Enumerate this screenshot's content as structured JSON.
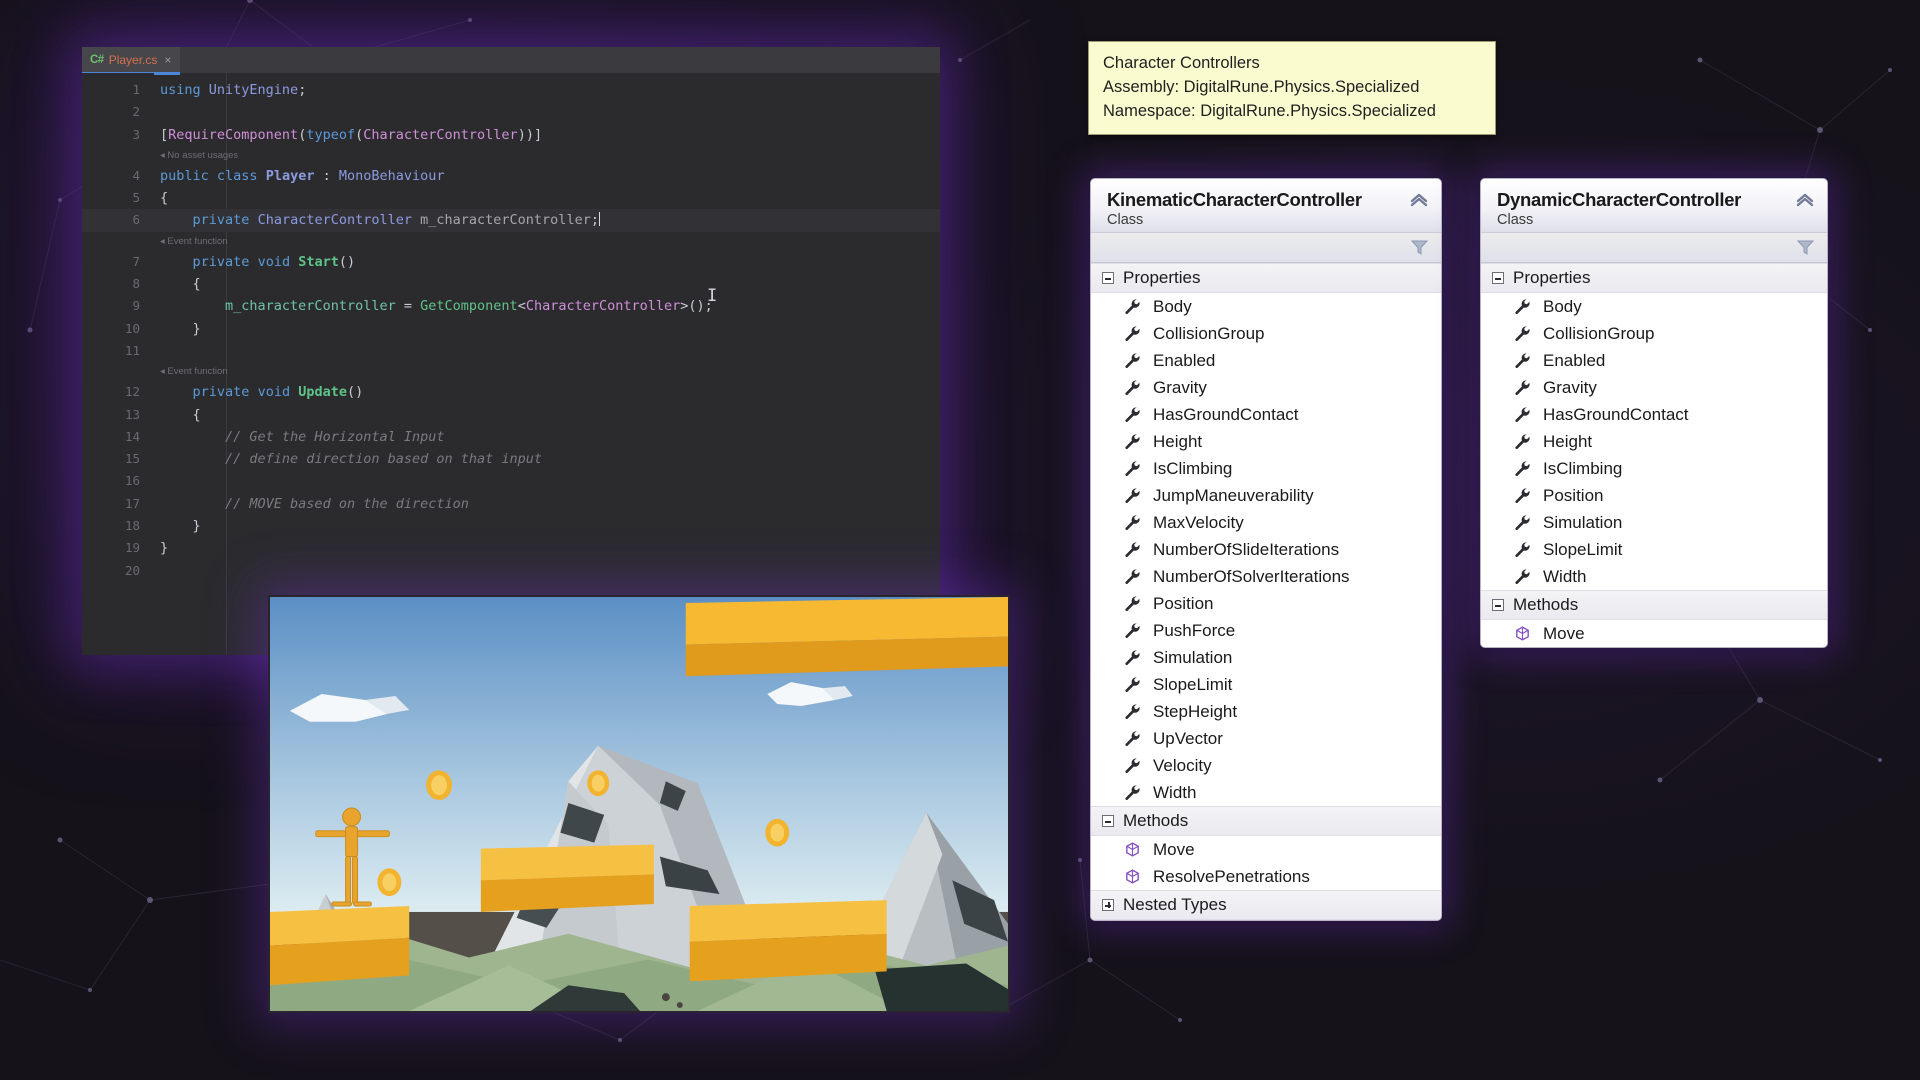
{
  "editor": {
    "tab": {
      "icon": "csharp-icon",
      "badge": "C#",
      "label": "Player.cs",
      "close": "×"
    },
    "lines": [
      {
        "n": "1",
        "html": "<span class='k'>using</span> <span class='ty'>UnityEngine</span><span class='pn'>;</span>"
      },
      {
        "n": "2",
        "html": ""
      },
      {
        "n": "3",
        "html": "<span class='pn'>[</span><span class='kw'>RequireComponent</span><span class='pn'>(</span><span class='k'>typeof</span><span class='pn'>(</span><span class='kw'>CharacterController</span><span class='pn'>))]</span>"
      },
      {
        "n": "",
        "ann": "No asset usages"
      },
      {
        "n": "4",
        "html": "<span class='k'>public</span> <span class='k'>class</span> <span class='ty'><b>Player</b></span> <span class='pn'>:</span> <span class='ty'>MonoBehaviour</span>"
      },
      {
        "n": "5",
        "html": "<span class='pn'>{</span>"
      },
      {
        "n": "6",
        "hl": true,
        "indent": true,
        "html": "    <span class='k'>private</span> <span class='ty'>CharacterController</span> <span class='id'>m_characterController</span><span class='pn'>;</span><span class='caret'></span>"
      },
      {
        "n": "",
        "ann": "Event function"
      },
      {
        "n": "7",
        "fold": "...",
        "html": "    <span class='k'>private</span> <span class='k'>void</span> <span class='fn'><b>Start</b></span><span class='pn'>()</span>"
      },
      {
        "n": "8",
        "html": "    <span class='pn'>{</span>"
      },
      {
        "n": "9",
        "html": "        <span class='cn'>m_characterController</span> <span class='pn'>=</span> <span class='fn'>GetComponent</span><span class='pn'>&lt;</span><span class='kw'>CharacterController</span><span class='pn'>&gt;();</span>"
      },
      {
        "n": "10",
        "html": "    <span class='pn'>}</span>"
      },
      {
        "n": "11",
        "html": ""
      },
      {
        "n": "",
        "ann": "Event function"
      },
      {
        "n": "12",
        "html": "    <span class='k'>private</span> <span class='k'>void</span> <span class='fn'><b>Update</b></span><span class='pn'>()</span>"
      },
      {
        "n": "13",
        "html": "    <span class='pn'>{</span>"
      },
      {
        "n": "14",
        "html": "        <span class='cm'>// Get the Horizontal Input</span>"
      },
      {
        "n": "15",
        "html": "        <span class='cm'>// define direction based on that input</span>"
      },
      {
        "n": "16",
        "html": ""
      },
      {
        "n": "17",
        "html": "        <span class='cm'>// MOVE based on the direction</span>"
      },
      {
        "n": "18",
        "html": "    <span class='pn'>}</span>"
      },
      {
        "n": "19",
        "html": "<span class='pn'>}</span>"
      },
      {
        "n": "20",
        "html": ""
      }
    ]
  },
  "tooltip": {
    "line1": "Character Controllers",
    "line2": "Assembly: DigitalRune.Physics.Specialized",
    "line3": "Namespace: DigitalRune.Physics.Specialized"
  },
  "panels": [
    {
      "id": "kinematic",
      "title": "KinematicCharacterController",
      "subtitle": "Class",
      "collapse_icon": "chevron-up-icon",
      "filter_icon": "filter-funnel-icon",
      "sections": [
        {
          "label": "Properties",
          "state": "expanded",
          "items": [
            "Body",
            "CollisionGroup",
            "Enabled",
            "Gravity",
            "HasGroundContact",
            "Height",
            "IsClimbing",
            "JumpManeuverability",
            "MaxVelocity",
            "NumberOfSlideIterations",
            "NumberOfSolverIterations",
            "Position",
            "PushForce",
            "Simulation",
            "SlopeLimit",
            "StepHeight",
            "UpVector",
            "Velocity",
            "Width"
          ],
          "icon": "wrench-icon"
        },
        {
          "label": "Methods",
          "state": "expanded",
          "items": [
            "Move",
            "ResolvePenetrations"
          ],
          "icon": "method-cube-icon"
        },
        {
          "label": "Nested Types",
          "state": "collapsed",
          "items": [],
          "icon": "none"
        }
      ]
    },
    {
      "id": "dynamic",
      "title": "DynamicCharacterController",
      "subtitle": "Class",
      "collapse_icon": "chevron-up-icon",
      "filter_icon": "filter-funnel-icon",
      "sections": [
        {
          "label": "Properties",
          "state": "expanded",
          "items": [
            "Body",
            "CollisionGroup",
            "Enabled",
            "Gravity",
            "HasGroundContact",
            "Height",
            "IsClimbing",
            "Position",
            "Simulation",
            "SlopeLimit",
            "Width"
          ],
          "icon": "wrench-icon"
        },
        {
          "label": "Methods",
          "state": "expanded",
          "items": [
            "Move"
          ],
          "icon": "method-cube-icon"
        }
      ]
    }
  ],
  "game_view": {
    "name": "unity-game-viewport",
    "description": "Low-poly 3D platformer scene with mountain, orange platforms, coins and a character"
  },
  "colors": {
    "background": "#15121a",
    "glow_purple": "#6e32be",
    "editor_bg": "#2b2b2e",
    "tooltip_bg": "#fbfbd0",
    "panel_bg": "#ffffff",
    "platform_orange": "#f5a623",
    "tab_accent": "#4b86d8"
  }
}
